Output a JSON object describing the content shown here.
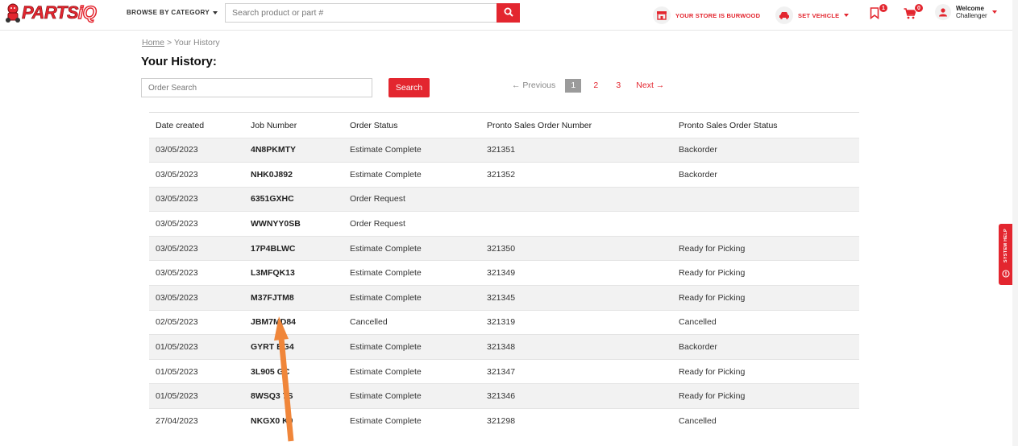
{
  "header": {
    "logo_parts": "PARTS",
    "logo_iq": "iQ",
    "browse_label": "BROWSE BY CATEGORY",
    "search_placeholder": "Search product or part #",
    "store_label": "YOUR STORE IS BURWOOD",
    "vehicle_label": "SET VEHICLE",
    "saved_count": "1",
    "cart_count": "0",
    "welcome_line1": "Welcome",
    "welcome_line2": "Challenger"
  },
  "breadcrumb": {
    "home": "Home",
    "separator": ">",
    "current": "Your History"
  },
  "page_title": "Your History:",
  "order_search": {
    "placeholder": "Order Search",
    "button_label": "Search"
  },
  "pagination": {
    "prev": "← Previous",
    "pages": [
      "1",
      "2",
      "3"
    ],
    "active_page": "1",
    "next": "Next →"
  },
  "table": {
    "columns": [
      "Date created",
      "Job Number",
      "Order Status",
      "Pronto Sales Order Number",
      "Pronto Sales Order Status"
    ],
    "rows": [
      [
        "03/05/2023",
        "4N8PKMTY",
        "Estimate Complete",
        "321351",
        "Backorder"
      ],
      [
        "03/05/2023",
        "NHK0J892",
        "Estimate Complete",
        "321352",
        "Backorder"
      ],
      [
        "03/05/2023",
        "6351GXHC",
        "Order Request",
        "",
        ""
      ],
      [
        "03/05/2023",
        "WWNYY0SB",
        "Order Request",
        "",
        ""
      ],
      [
        "03/05/2023",
        "17P4BLWC",
        "Estimate Complete",
        "321350",
        "Ready for Picking"
      ],
      [
        "03/05/2023",
        "L3MFQK13",
        "Estimate Complete",
        "321349",
        "Ready for Picking"
      ],
      [
        "03/05/2023",
        "M37FJTM8",
        "Estimate Complete",
        "321345",
        "Ready for Picking"
      ],
      [
        "02/05/2023",
        "JBM7MD84",
        "Cancelled",
        "321319",
        "Cancelled"
      ],
      [
        "01/05/2023",
        "GYRT BG4",
        "Estimate Complete",
        "321348",
        "Backorder"
      ],
      [
        "01/05/2023",
        "3L905 GC",
        "Estimate Complete",
        "321347",
        "Ready for Picking"
      ],
      [
        "01/05/2023",
        "8WSQ3 7S",
        "Estimate Complete",
        "321346",
        "Ready for Picking"
      ],
      [
        "27/04/2023",
        "NKGX0 K0",
        "Estimate Complete",
        "321298",
        "Cancelled"
      ]
    ]
  },
  "help_tab": {
    "label": "SYSTEM HELP"
  },
  "colors": {
    "brand_red": "#e3262f",
    "annotation_arrow": "#f0863a",
    "row_stripe": "#f2f2f2",
    "active_page_bg": "#9b9b9b"
  },
  "icons": {
    "search": "magnifier-icon",
    "store": "storefront-icon",
    "vehicle": "car-icon",
    "saved": "bookmark-icon",
    "cart": "cart-icon",
    "user": "user-icon",
    "help": "help-bubble-icon"
  }
}
